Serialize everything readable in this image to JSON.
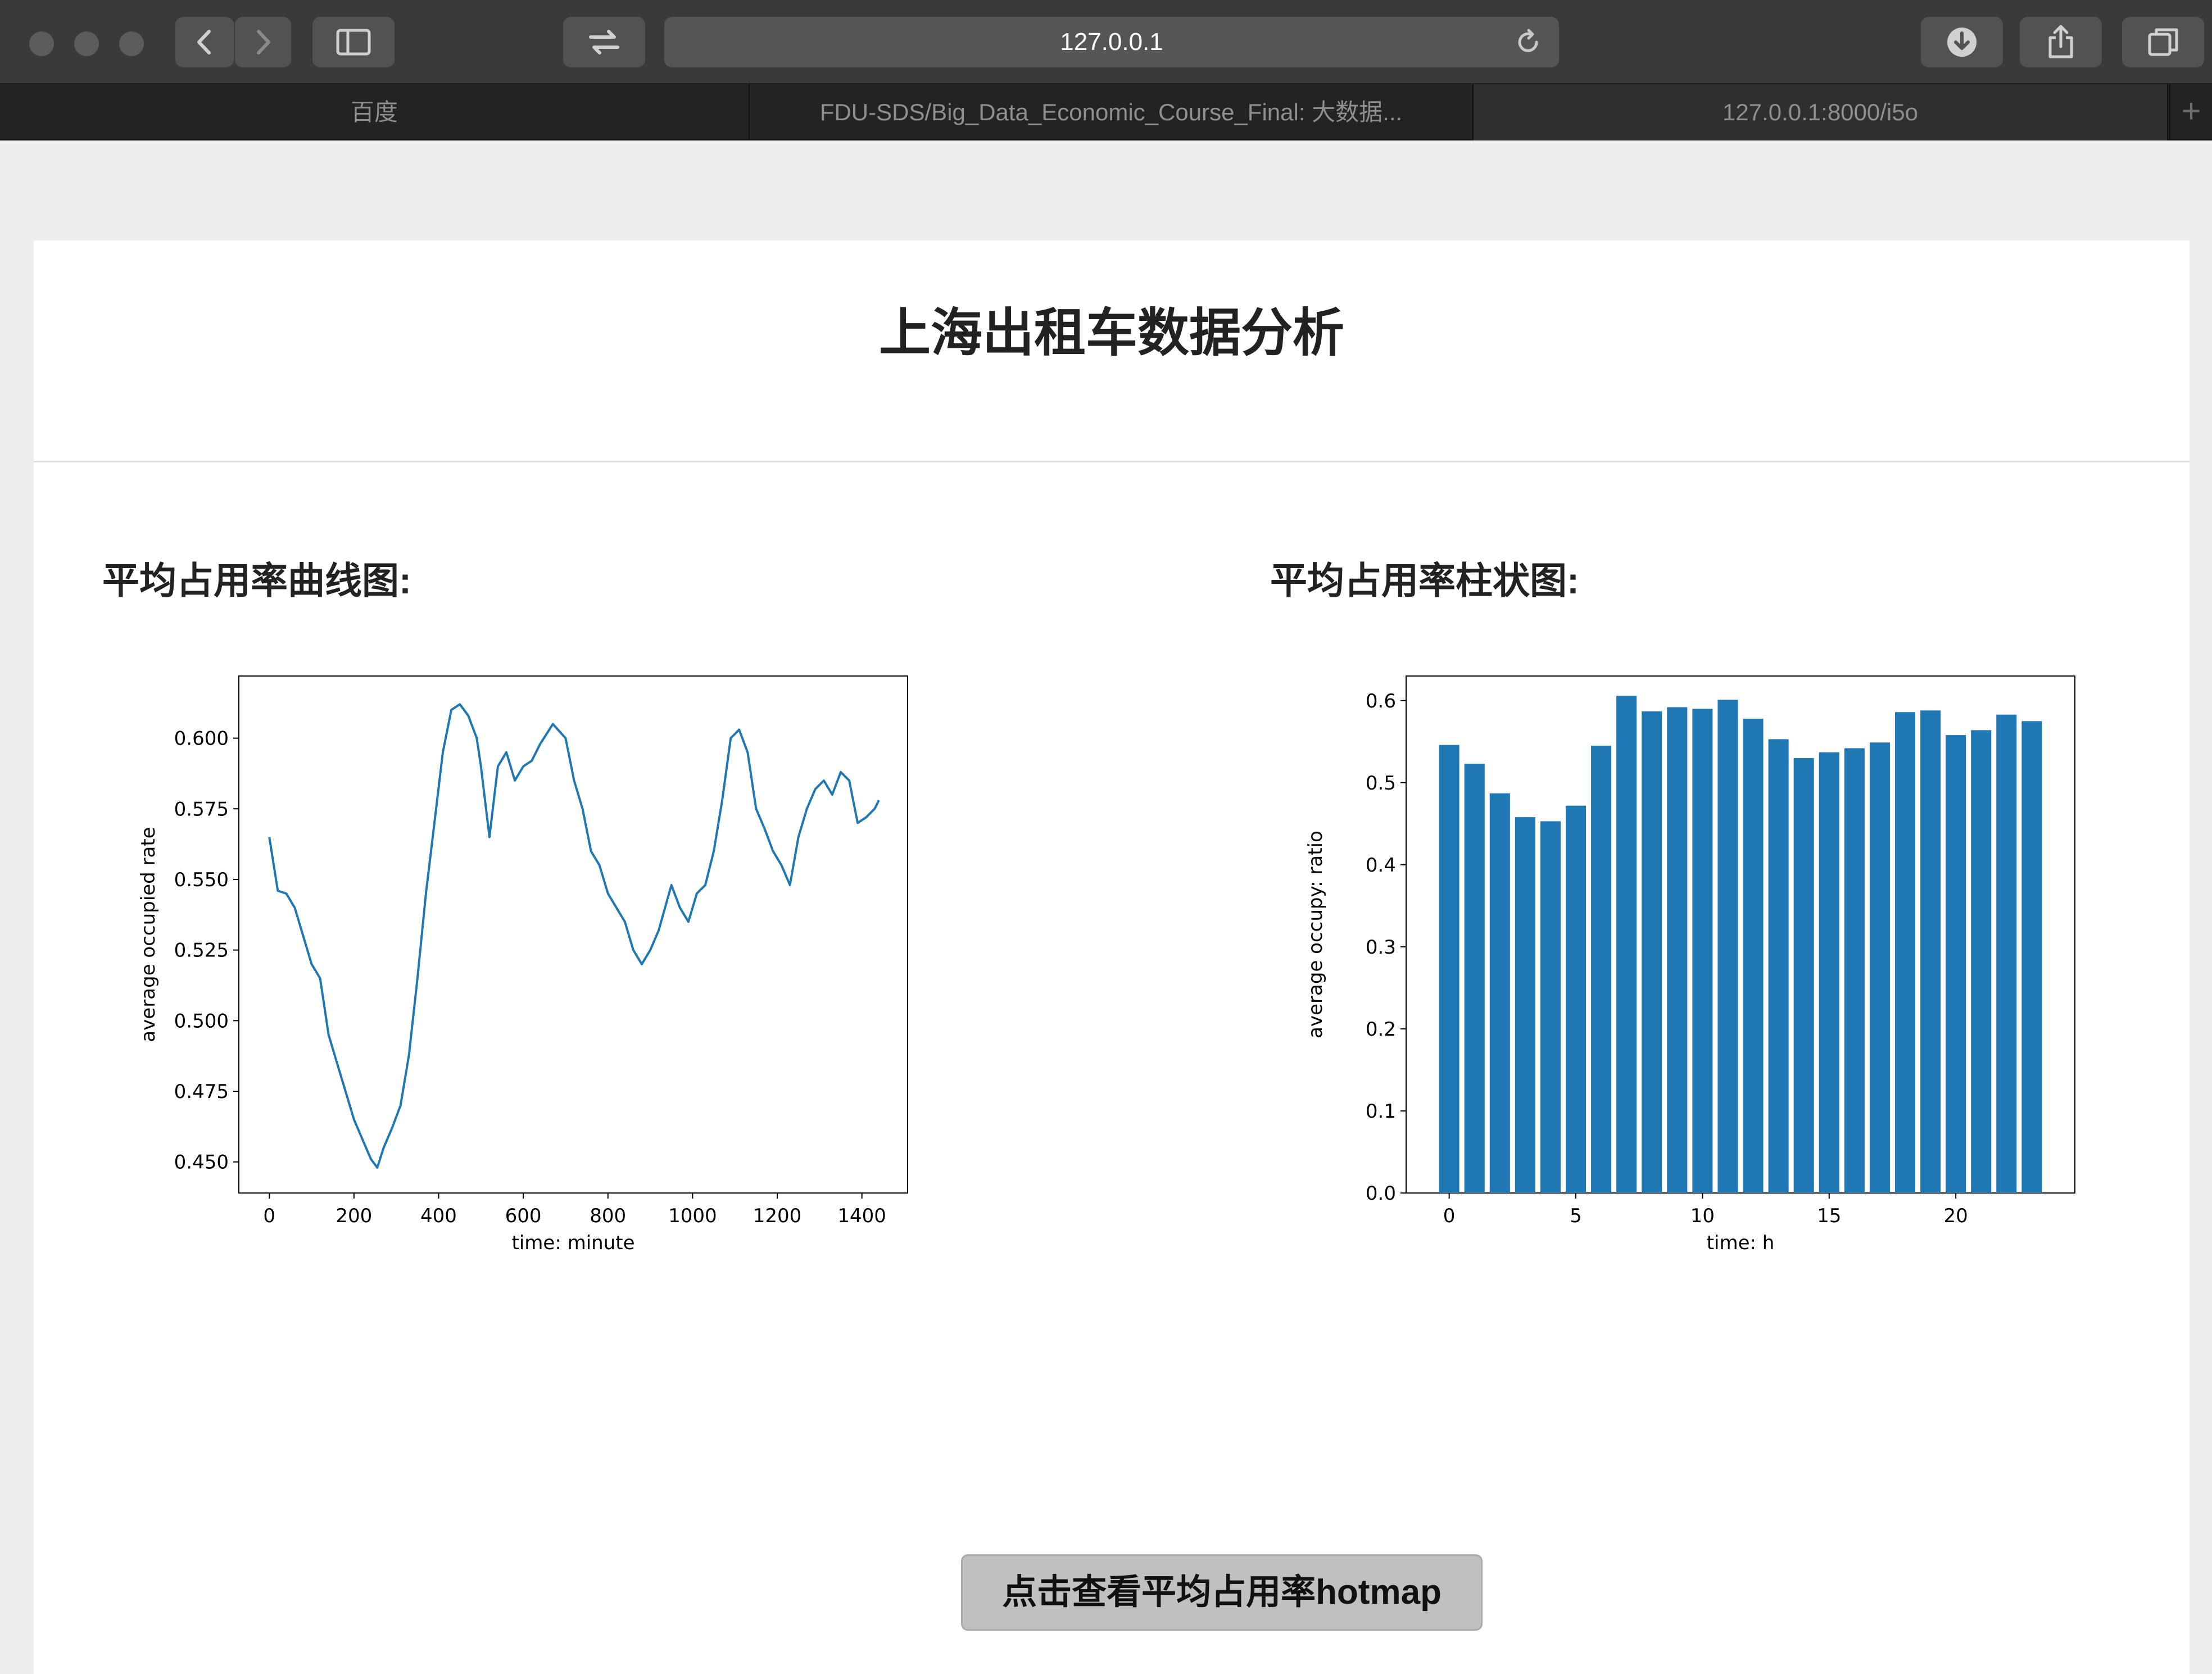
{
  "browser": {
    "address": "127.0.0.1",
    "tabs": [
      {
        "label": "百度",
        "active": false
      },
      {
        "label": "FDU-SDS/Big_Data_Economic_Course_Final: 大数据...",
        "active": false
      },
      {
        "label": "127.0.0.1:8000/i5o",
        "active": true
      }
    ],
    "new_tab": "+"
  },
  "page": {
    "title": "上海出租车数据分析",
    "line_section_title": "平均占用率曲线图:",
    "bar_section_title": "平均占用率柱状图:",
    "hotmap_button": "点击查看平均占用率hotmap"
  },
  "colors": {
    "series": "#1f77b4",
    "button_bg": "#c0c0c0"
  },
  "icons": [
    "back-icon",
    "forward-icon",
    "sidebar-icon",
    "share-tab-icon",
    "reload-icon",
    "download-icon",
    "share-icon",
    "tabs-overview-icon"
  ],
  "chart_data": [
    {
      "type": "line",
      "title": "",
      "xlabel": "time: minute",
      "ylabel": "average occupied rate",
      "xlim": [
        -72,
        1508
      ],
      "ylim": [
        0.439,
        0.622
      ],
      "xticks": [
        0,
        200,
        400,
        600,
        800,
        1000,
        1200,
        1400
      ],
      "yticks": [
        0.45,
        0.475,
        0.5,
        0.525,
        0.55,
        0.575,
        0.6
      ],
      "grid": false,
      "series": [
        {
          "x": [
            0,
            20,
            40,
            60,
            80,
            100,
            120,
            140,
            160,
            180,
            200,
            220,
            240,
            255,
            270,
            290,
            310,
            330,
            350,
            370,
            390,
            410,
            430,
            450,
            470,
            490,
            500,
            520,
            540,
            560,
            580,
            600,
            620,
            640,
            670,
            700,
            720,
            740,
            760,
            780,
            800,
            820,
            840,
            860,
            880,
            900,
            920,
            950,
            970,
            990,
            1010,
            1030,
            1050,
            1070,
            1090,
            1110,
            1130,
            1150,
            1170,
            1190,
            1210,
            1230,
            1250,
            1270,
            1290,
            1310,
            1330,
            1350,
            1370,
            1390,
            1410,
            1430,
            1440
          ],
          "values": [
            0.565,
            0.546,
            0.545,
            0.54,
            0.53,
            0.52,
            0.515,
            0.495,
            0.485,
            0.475,
            0.465,
            0.458,
            0.451,
            0.448,
            0.455,
            0.462,
            0.47,
            0.488,
            0.515,
            0.545,
            0.57,
            0.595,
            0.61,
            0.612,
            0.608,
            0.6,
            0.59,
            0.565,
            0.59,
            0.595,
            0.585,
            0.59,
            0.592,
            0.598,
            0.605,
            0.6,
            0.585,
            0.575,
            0.56,
            0.555,
            0.545,
            0.54,
            0.535,
            0.525,
            0.52,
            0.525,
            0.532,
            0.548,
            0.54,
            0.535,
            0.545,
            0.548,
            0.56,
            0.578,
            0.6,
            0.603,
            0.595,
            0.575,
            0.568,
            0.56,
            0.555,
            0.548,
            0.565,
            0.575,
            0.582,
            0.585,
            0.58,
            0.588,
            0.585,
            0.57,
            0.572,
            0.575,
            0.578
          ]
        }
      ]
    },
    {
      "type": "bar",
      "title": "",
      "xlabel": "time: h",
      "ylabel": "average occupy: ratio",
      "xlim": [
        -1.7,
        24.7
      ],
      "ylim": [
        0.0,
        0.63
      ],
      "xticks": [
        0,
        5,
        10,
        15,
        20
      ],
      "yticks": [
        0.0,
        0.1,
        0.2,
        0.3,
        0.4,
        0.5,
        0.6
      ],
      "grid": false,
      "categories": [
        0,
        1,
        2,
        3,
        4,
        5,
        6,
        7,
        8,
        9,
        10,
        11,
        12,
        13,
        14,
        15,
        16,
        17,
        18,
        19,
        20,
        21,
        22,
        23
      ],
      "values": [
        0.546,
        0.523,
        0.487,
        0.458,
        0.453,
        0.472,
        0.545,
        0.606,
        0.587,
        0.592,
        0.59,
        0.601,
        0.578,
        0.553,
        0.53,
        0.537,
        0.542,
        0.549,
        0.586,
        0.588,
        0.558,
        0.564,
        0.583,
        0.575
      ]
    }
  ]
}
